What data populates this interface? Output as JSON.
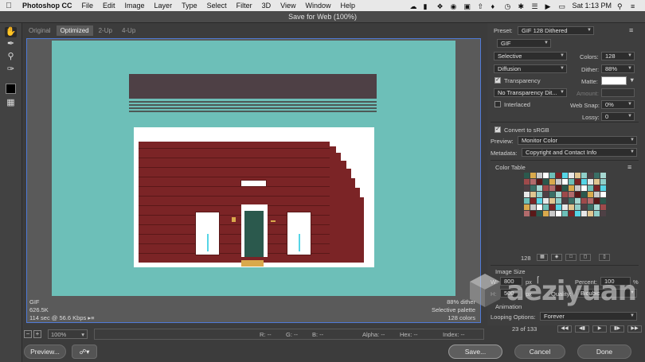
{
  "menubar": {
    "app": "Photoshop CC",
    "items": [
      "File",
      "Edit",
      "Image",
      "Layer",
      "Type",
      "Select",
      "Filter",
      "3D",
      "View",
      "Window",
      "Help"
    ],
    "clock": "Sat 1:13 PM"
  },
  "dialog": {
    "title": "Save for Web (100%)"
  },
  "tabs": [
    "Original",
    "Optimized",
    "2-Up",
    "4-Up"
  ],
  "canvas_info": {
    "format": "GIF",
    "size": "626.5K",
    "download": "114 sec @ 56.6 Kbps",
    "dither": "88% dither",
    "palette": "Selective palette",
    "colors": "128 colors"
  },
  "status": {
    "zoom": "100%",
    "r": "R: --",
    "g": "G: --",
    "b": "B: --",
    "alpha": "Alpha: --",
    "hex": "Hex: --",
    "index": "Index: --"
  },
  "buttons": {
    "preview": "Preview...",
    "save": "Save...",
    "cancel": "Cancel",
    "done": "Done"
  },
  "settings": {
    "preset_label": "Preset:",
    "preset": "GIF 128 Dithered",
    "format": "GIF",
    "reduction": "Selective",
    "colors_label": "Colors:",
    "colors": "128",
    "dither_algo": "Diffusion",
    "dither_label": "Dither:",
    "dither": "88%",
    "transparency_label": "Transparency",
    "transparency_checked": true,
    "matte_label": "Matte:",
    "matte_color": "#ffffff",
    "trans_dither": "No Transparency Dit...",
    "amount_label": "Amount:",
    "interlaced_label": "Interlaced",
    "interlaced_checked": false,
    "websnap_label": "Web Snap:",
    "websnap": "0%",
    "lossy_label": "Lossy:",
    "lossy": "0",
    "convert_label": "Convert to sRGB",
    "convert_checked": true,
    "preview_label": "Preview:",
    "preview_mode": "Monitor Color",
    "metadata_label": "Metadata:",
    "metadata": "Copyright and Contact Info",
    "color_table_label": "Color Table",
    "color_count": "128",
    "image_size_label": "Image Size",
    "w_label": "W:",
    "w": "800",
    "h_label": "H:",
    "h": "500",
    "px": "px",
    "percent_label": "Percent:",
    "percent": "100",
    "pct": "%",
    "quality_label": "Quality:",
    "quality": "Bicubic",
    "animation_label": "Animation",
    "looping_label": "Looping Options:",
    "looping": "Forever",
    "frame": "23 of 133"
  },
  "palette": [
    "#6dbfb8",
    "#7b2426",
    "#4e4045",
    "#ffffff",
    "#2b594d",
    "#d9a94c",
    "#56d5e6",
    "#5a1818",
    "#a6d8d2",
    "#9e4a4b",
    "#c9c9c9",
    "#3a6f66",
    "#e0c590",
    "#8fcfc9",
    "#b26b6c",
    "#e8e8e8"
  ],
  "watermark": "aeziyuan"
}
